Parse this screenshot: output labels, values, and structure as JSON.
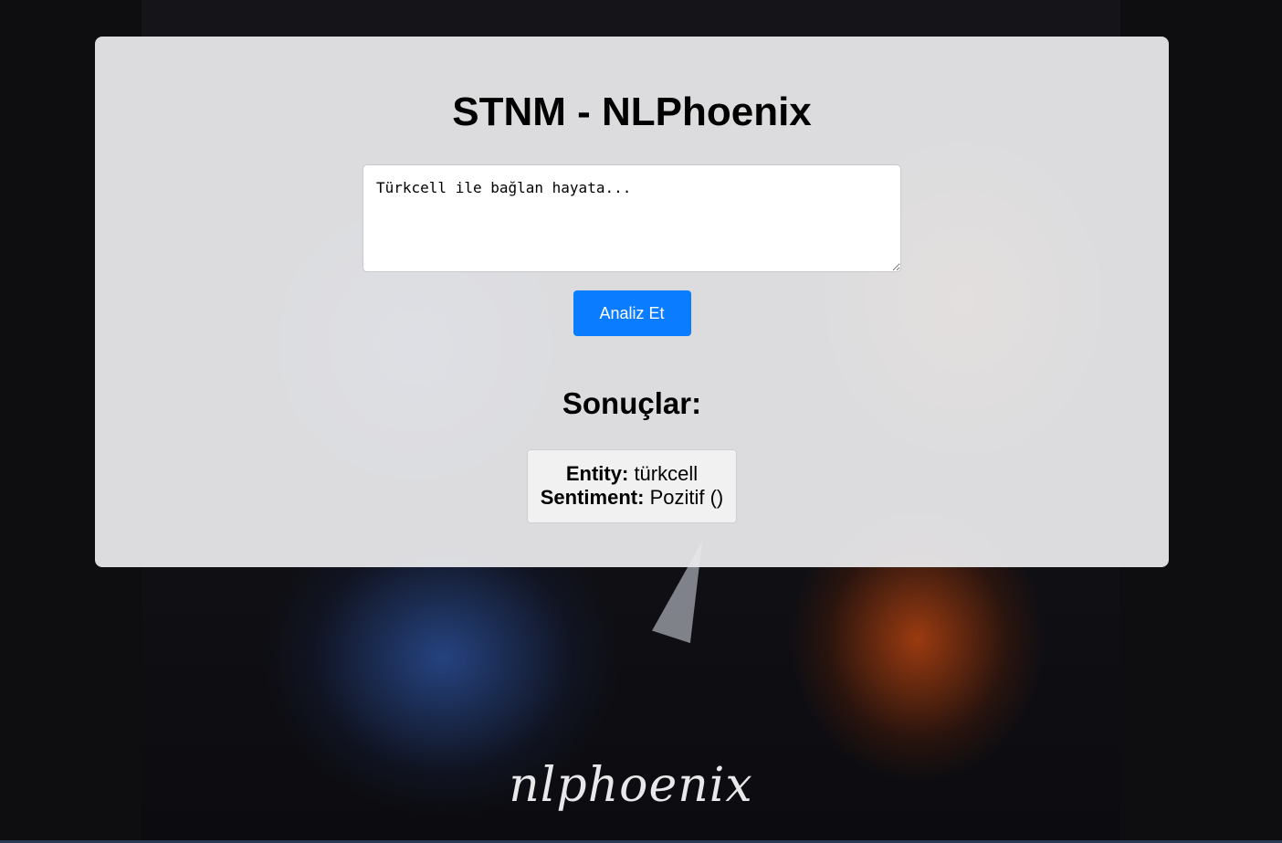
{
  "header": {
    "title": "STNM - NLPhoenix"
  },
  "input": {
    "value": "Türkcell ile bağlan hayata..."
  },
  "actions": {
    "analyze_label": "Analiz Et"
  },
  "results": {
    "title": "Sonuçlar:",
    "items": [
      {
        "entity_label": "Entity:",
        "entity_value": "türkcell",
        "sentiment_label": "Sentiment:",
        "sentiment_value": "Pozitif ()"
      }
    ]
  },
  "background": {
    "logo_text": "nlphoenix"
  },
  "colors": {
    "accent": "#0a7cff",
    "page_background": "#0e0d10",
    "card_background": "#ececee"
  }
}
